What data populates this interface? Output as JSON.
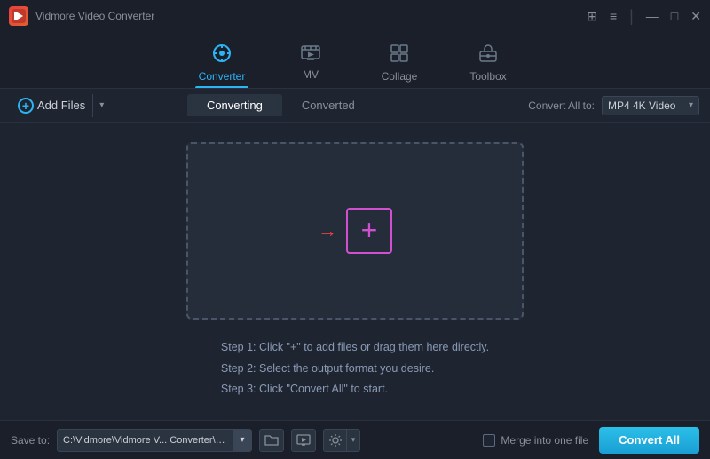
{
  "titleBar": {
    "appName": "Vidmore Video Converter",
    "logo": "V",
    "controls": {
      "grid": "⊞",
      "menu": "≡",
      "minimize": "—",
      "maximize": "□",
      "close": "✕"
    }
  },
  "navTabs": [
    {
      "id": "converter",
      "label": "Converter",
      "icon": "⊙",
      "active": true
    },
    {
      "id": "mv",
      "label": "MV",
      "icon": "🖼",
      "active": false
    },
    {
      "id": "collage",
      "label": "Collage",
      "icon": "⊞",
      "active": false
    },
    {
      "id": "toolbox",
      "label": "Toolbox",
      "icon": "🧰",
      "active": false
    }
  ],
  "toolbar": {
    "addFilesLabel": "Add Files",
    "subTabs": [
      {
        "label": "Converting",
        "active": true
      },
      {
        "label": "Converted",
        "active": false
      }
    ],
    "convertAllTo": "Convert All to:",
    "formatValue": "MP4 4K Video"
  },
  "dropZone": {
    "arrowChar": "→",
    "plusChar": "+"
  },
  "instructions": [
    "Step 1: Click \"+\" to add files or drag them here directly.",
    "Step 2: Select the output format you desire.",
    "Step 3: Click \"Convert All\" to start."
  ],
  "bottomBar": {
    "saveToLabel": "Save to:",
    "savePath": "C:\\Vidmore\\Vidmore V... Converter\\Converted",
    "mergeLabel": "Merge into one file",
    "convertAllLabel": "Convert All",
    "folderIcon": "📁",
    "videoIcon": "📽",
    "settingsIcon": "⚙"
  }
}
